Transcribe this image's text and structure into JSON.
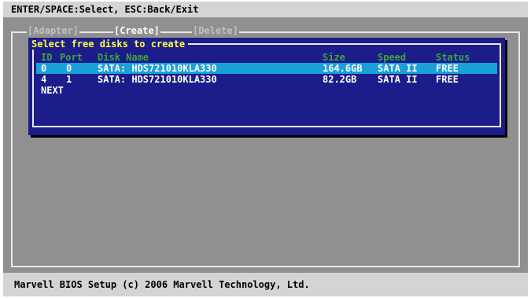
{
  "title_bar": "ENTER/SPACE:Select, ESC:Back/Exit",
  "tabs": [
    {
      "label": "[Adapter]",
      "active": false
    },
    {
      "label": "[Create]",
      "active": true
    },
    {
      "label": "[Delete]",
      "active": false
    }
  ],
  "panel": {
    "title": "Select free disks to create",
    "columns": [
      "ID",
      "Port",
      "Disk Name",
      "Size",
      "Speed",
      "Status"
    ],
    "disks": [
      {
        "id": "0",
        "port": "0",
        "name": "SATA: HDS721010KLA330",
        "size": "164.6GB",
        "speed": "SATA II",
        "status": "FREE",
        "selected": true
      },
      {
        "id": "4",
        "port": "1",
        "name": "SATA: HDS721010KLA330",
        "size": "82.2GB",
        "speed": "SATA II",
        "status": "FREE",
        "selected": false
      }
    ],
    "next_label": "NEXT"
  },
  "status_bar": "Marvell BIOS Setup (c) 2006 Marvell Technology, Ltd.",
  "colors": {
    "panel_bg": "#1c1c8a",
    "highlight": "#18a0d8",
    "header_text": "#3aa83a",
    "title_text": "#ffff40"
  }
}
